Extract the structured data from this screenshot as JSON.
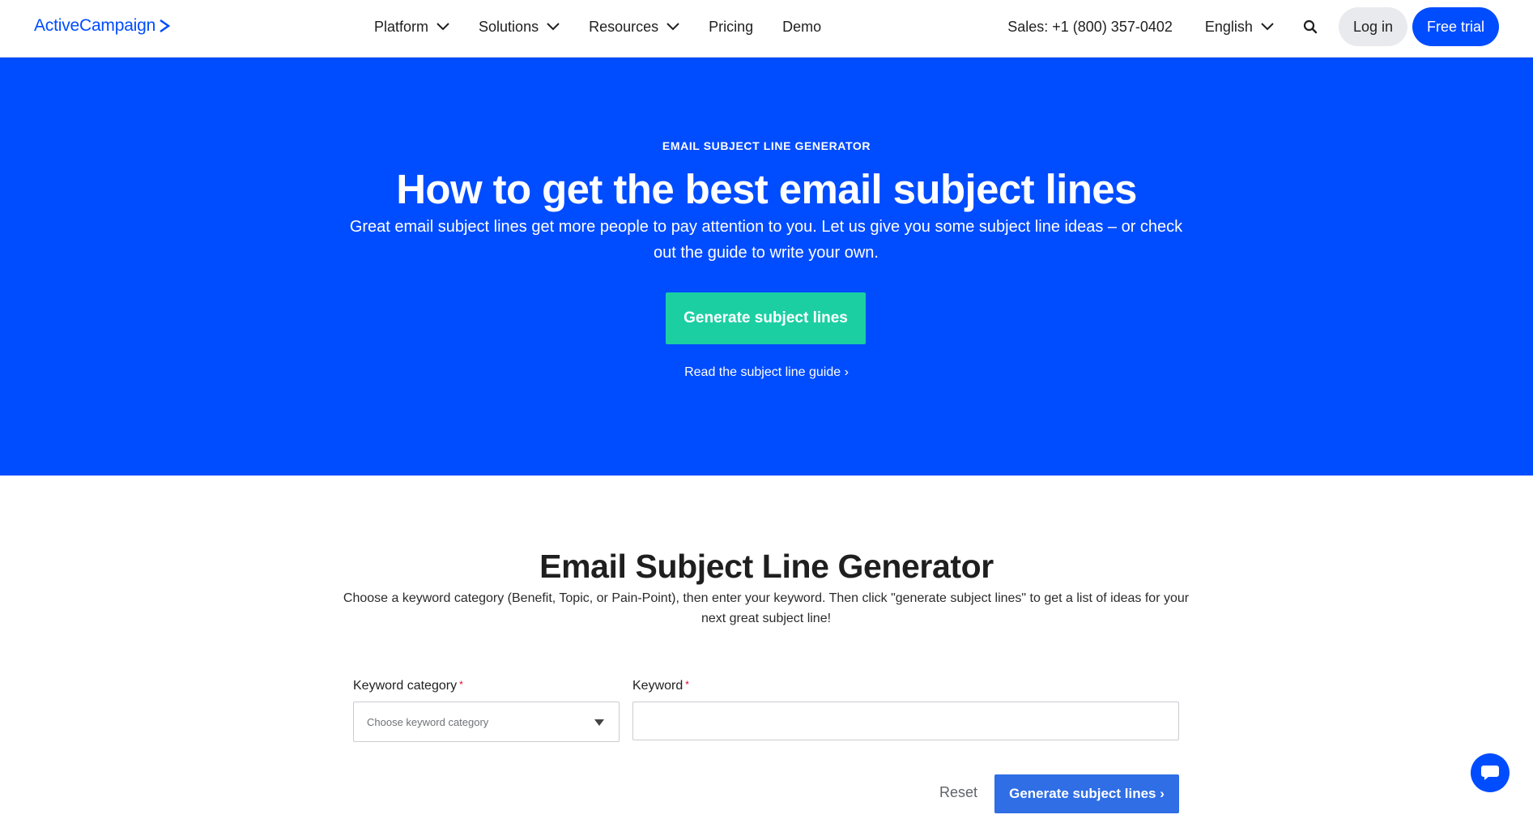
{
  "brand": {
    "name": "ActiveCampaign",
    "accent": "#004cff"
  },
  "nav": {
    "items": [
      {
        "label": "Platform",
        "dropdown": true
      },
      {
        "label": "Solutions",
        "dropdown": true
      },
      {
        "label": "Resources",
        "dropdown": true
      },
      {
        "label": "Pricing",
        "dropdown": false
      },
      {
        "label": "Demo",
        "dropdown": false
      }
    ],
    "sales": "Sales: +1 (800) 357-0402",
    "language": "English",
    "search_icon": "search-icon",
    "login_label": "Log in",
    "trial_label": "Free trial"
  },
  "hero": {
    "eyebrow": "EMAIL SUBJECT LINE GENERATOR",
    "title": "How to get the best email subject lines",
    "subtitle": "Great email subject lines get more people to pay attention to you. Let us give you some subject line ideas – or check out the guide to write your own.",
    "cta_label": "Generate subject lines",
    "cta_color": "#1ccfa3",
    "guide_link": "Read the subject line guide ›"
  },
  "generator": {
    "title": "Email Subject Line Generator",
    "description": "Choose a keyword category (Benefit, Topic, or Pain-Point), then enter your keyword. Then click \"generate subject lines\" to get a list of ideas for your next great subject line!",
    "category_label": "Keyword category",
    "category_placeholder": "Choose keyword category",
    "keyword_label": "Keyword",
    "keyword_value": "",
    "required_mark": "*",
    "reset_label": "Reset",
    "submit_label": "Generate subject lines ›"
  },
  "chat": {
    "icon": "chat-bubble-icon"
  }
}
